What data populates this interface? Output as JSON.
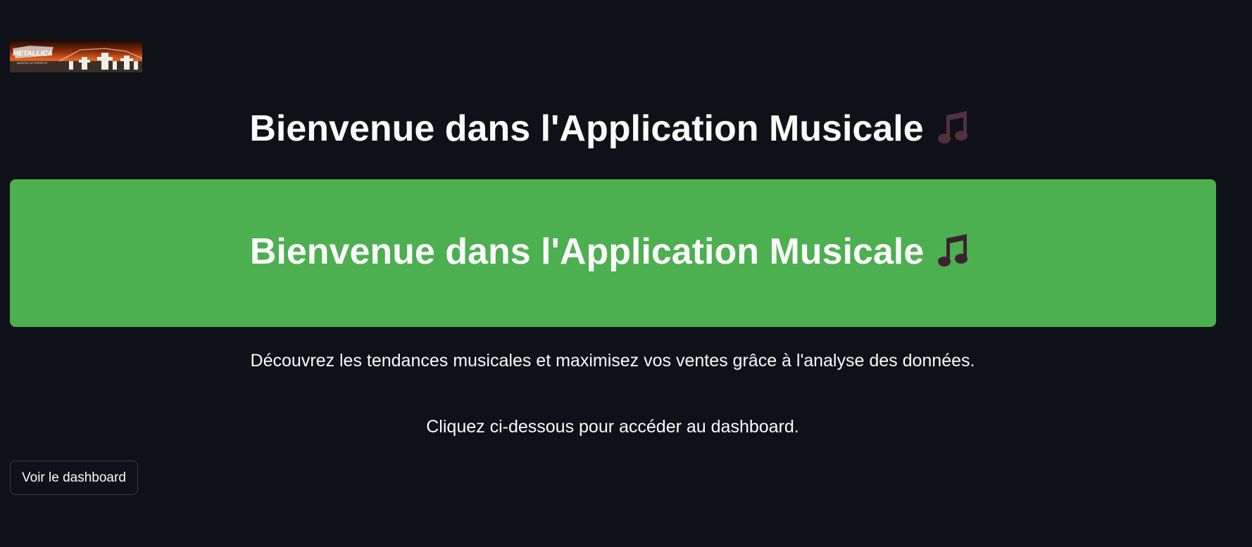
{
  "logo": {
    "name": "Metallica - Master of Puppets album cover",
    "text": "METALLICA",
    "subtext": "MASTER OF PUPPETS"
  },
  "title": "Bienvenue dans l'Application Musicale",
  "banner": {
    "title": "Bienvenue dans l'Application Musicale",
    "color": "#4caf50"
  },
  "emoji_icon": "musical-notes-icon",
  "description": "Découvrez les tendances musicales et maximisez vos ventes grâce à l'analyse des données.",
  "cta_text": "Cliquez ci-dessous pour accéder au dashboard.",
  "dashboard_button": {
    "label": "Voir le dashboard"
  },
  "colors": {
    "background": "#0e1117",
    "accent": "#4caf50",
    "text": "#fafafa"
  }
}
